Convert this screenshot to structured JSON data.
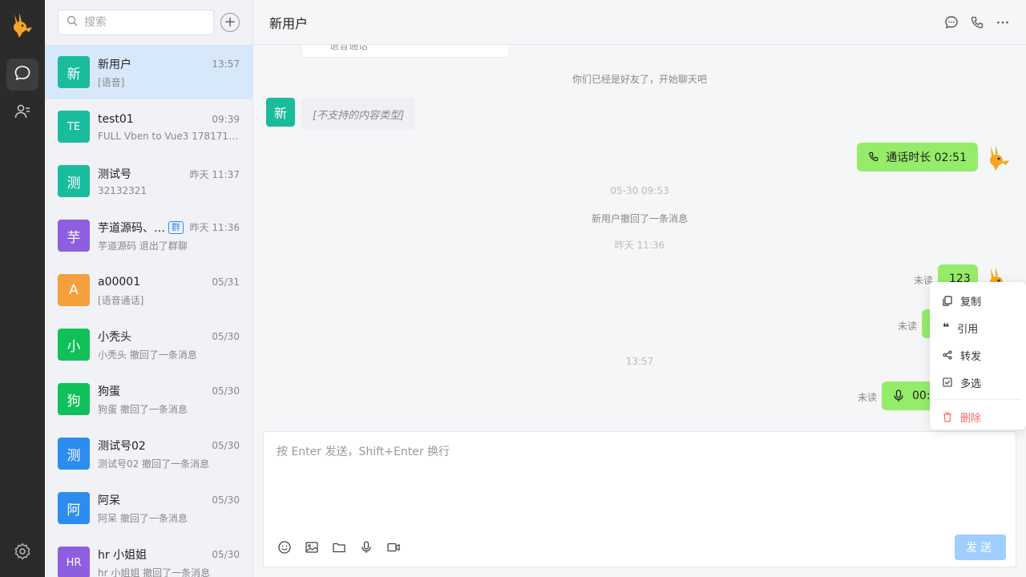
{
  "search": {
    "placeholder": "搜索"
  },
  "conversations": [
    {
      "avatar": "新",
      "name": "新用户",
      "time": "13:57",
      "last": "[语音]",
      "color": "#1abc9c",
      "group": ""
    },
    {
      "avatar": "TE",
      "name": "test01",
      "time": "09:39",
      "last": "FULL Vben to Vue3 17817143…",
      "color": "#1abc9c",
      "group": ""
    },
    {
      "avatar": "测",
      "name": "测试号",
      "time": "昨天 11:37",
      "last": "32132321",
      "color": "#1abc9c",
      "group": ""
    },
    {
      "avatar": "芋",
      "name": "芋道源码、…",
      "time": "昨天 11:36",
      "last": "芋道源码 退出了群聊",
      "color": "#8e5ee0",
      "group": "群"
    },
    {
      "avatar": "A",
      "name": "a00001",
      "time": "05/31",
      "last": "[语音通话]",
      "color": "#f5a03c",
      "group": ""
    },
    {
      "avatar": "小",
      "name": "小秃头",
      "time": "05/30",
      "last": "小秃头 撤回了一条消息",
      "color": "#12c05a",
      "group": ""
    },
    {
      "avatar": "狗",
      "name": "狗蛋",
      "time": "05/30",
      "last": "狗蛋 撤回了一条消息",
      "color": "#12c05a",
      "group": ""
    },
    {
      "avatar": "测",
      "name": "测试号02",
      "time": "05/30",
      "last": "测试号02 撤回了一条消息",
      "color": "#2d8cf0",
      "group": ""
    },
    {
      "avatar": "阿",
      "name": "阿呆",
      "time": "05/30",
      "last": "阿呆 撤回了一条消息",
      "color": "#2d8cf0",
      "group": ""
    },
    {
      "avatar": "HR",
      "name": "hr 小姐姐",
      "time": "05/30",
      "last": "hr 小姐姐 撤回了一条消息",
      "color": "#8e5ee0",
      "group": ""
    }
  ],
  "chat": {
    "title": "新用户",
    "prev_card_text": "语音通话",
    "friend_notice": "你们已经是好友了，开始聊天吧",
    "peer_avatar": "新",
    "unsupported": "[不支持的内容类型]",
    "call_duration": "通话时长 02:51",
    "time1": "05-30 09:53",
    "recall_notice": "新用户撤回了一条消息",
    "time2": "昨天 11:36",
    "msg_123": "123",
    "time3": "13:57",
    "voice_text": "00:",
    "unread": "未读"
  },
  "context_menu": {
    "copy": "复制",
    "quote": "引用",
    "forward": "转发",
    "multi": "多选",
    "delete": "删除"
  },
  "composer": {
    "placeholder": "按 Enter 发送，Shift+Enter 换行",
    "send": "发送"
  }
}
